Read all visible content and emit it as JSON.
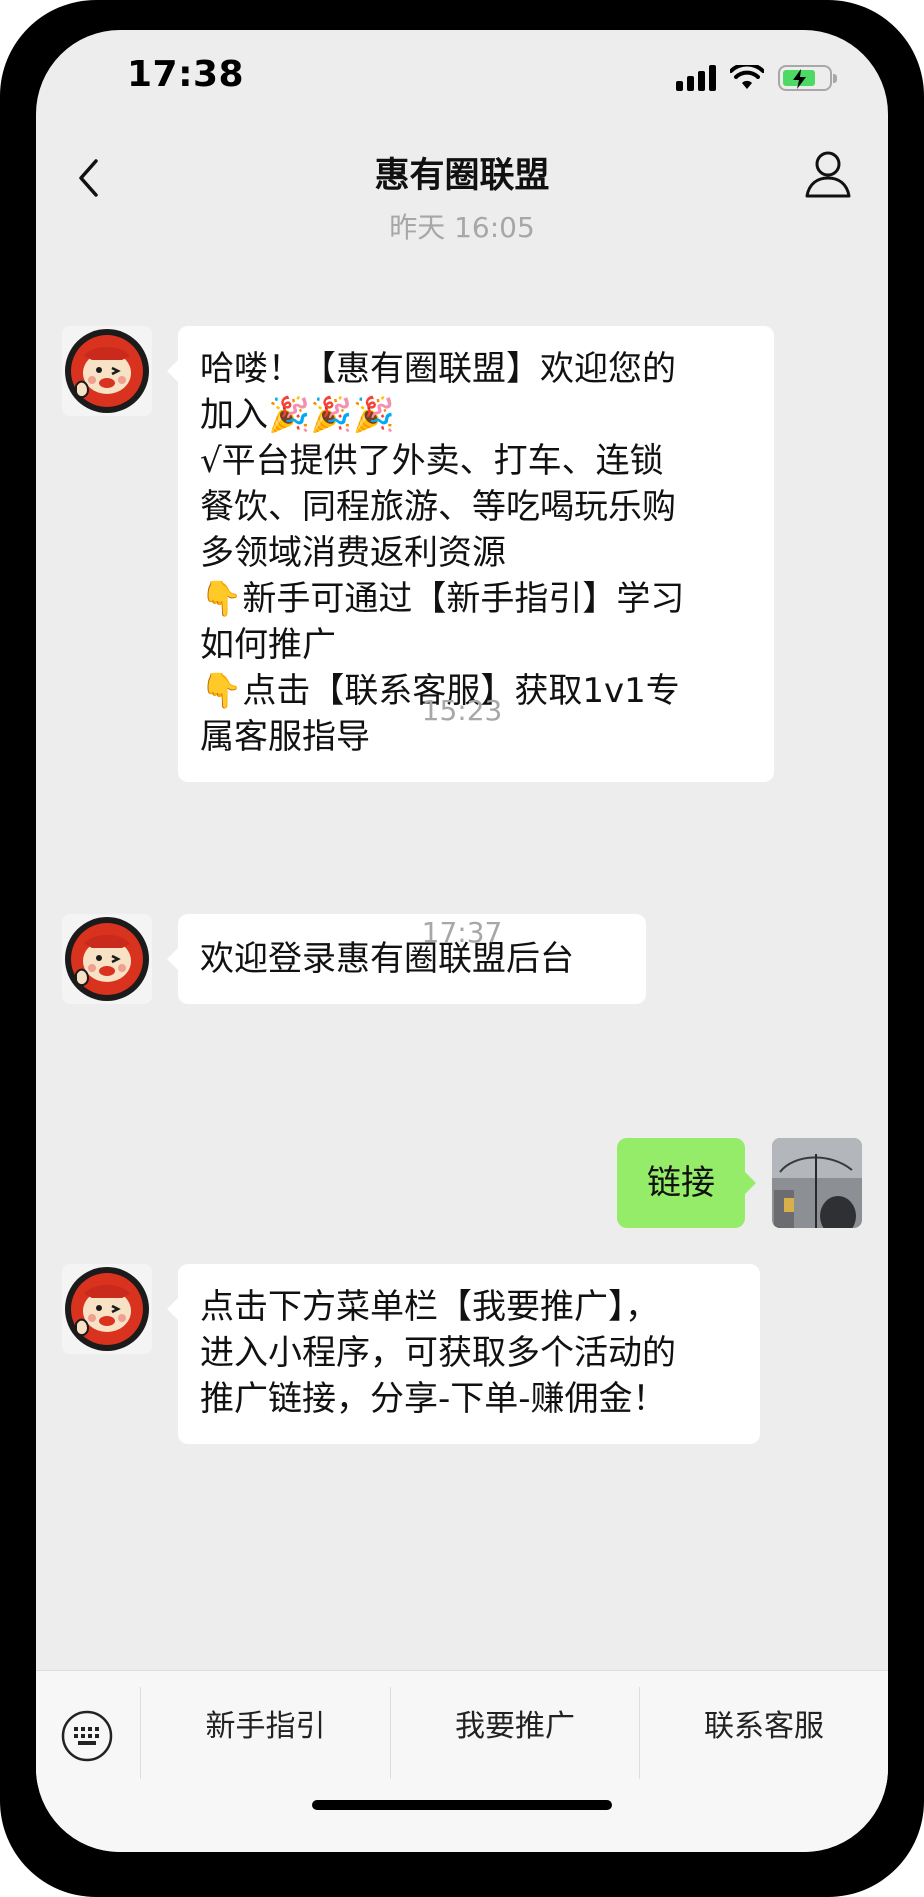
{
  "status_bar": {
    "time": "17:38"
  },
  "nav": {
    "title": "惠有圈联盟"
  },
  "messages": [
    {
      "timestamp": "昨天 16:05"
    },
    {
      "text": "哈喽！【惠有圈联盟】欢迎您的\n加入🎉🎉🎉\n√平台提供了外卖、打车、连锁\n餐饮、同程旅游、等吃喝玩乐购\n多领域消费返利资源\n👇新手可通过【新手指引】学习\n如何推广\n👇点击【联系客服】获取1v1专\n属客服指导"
    },
    {
      "timestamp": "15:23"
    },
    {
      "text": "欢迎登录惠有圈联盟后台"
    },
    {
      "timestamp": "17:37"
    },
    {
      "text": "链接"
    },
    {
      "text": "点击下方菜单栏【我要推广】，\n进入小程序，可获取多个活动的\n推广链接，分享-下单-赚佣金！"
    }
  ],
  "menu": {
    "items": [
      {
        "label": "新手指引"
      },
      {
        "label": "我要推广"
      },
      {
        "label": "联系客服"
      }
    ]
  },
  "colors": {
    "chat_background": "#ededed",
    "incoming_bubble": "#ffffff",
    "outgoing_bubble": "#95ec69"
  }
}
